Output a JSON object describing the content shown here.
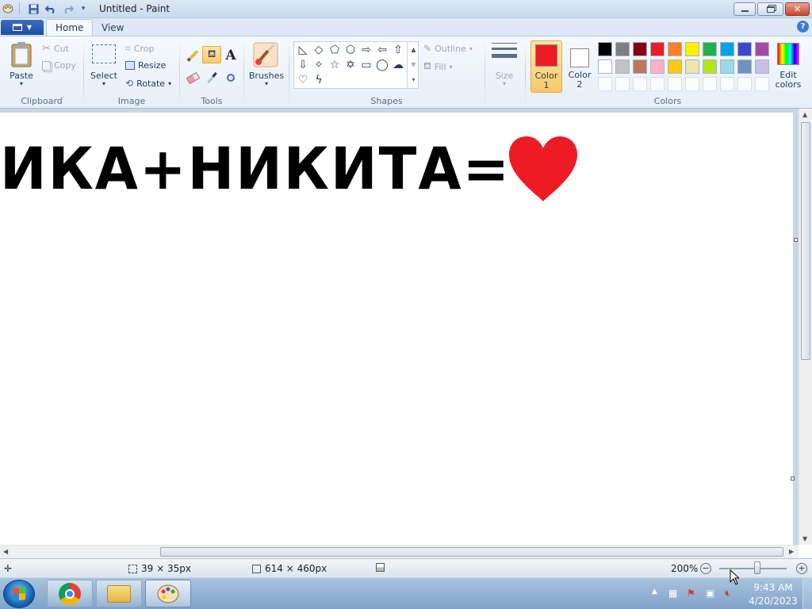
{
  "window": {
    "title": "Untitled - Paint",
    "min_icon": "minimize-icon",
    "max_icon": "restore-icon",
    "close_icon": "close-icon"
  },
  "tabs": {
    "home": "Home",
    "view": "View"
  },
  "ribbon": {
    "clipboard": {
      "label": "Clipboard",
      "paste": "Paste",
      "cut": "Cut",
      "copy": "Copy"
    },
    "image": {
      "label": "Image",
      "select": "Select",
      "crop": "Crop",
      "resize": "Resize",
      "rotate": "Rotate"
    },
    "tools": {
      "label": "Tools",
      "text_glyph": "A"
    },
    "brushes": {
      "label": "Brushes"
    },
    "shapes": {
      "label": "Shapes",
      "outline": "Outline",
      "fill": "Fill"
    },
    "size": {
      "label": "Size"
    },
    "colors": {
      "label": "Colors",
      "color1_line1": "Color",
      "color1_line2": "1",
      "color2_line1": "Color",
      "color2_line2": "2",
      "edit_line1": "Edit",
      "edit_line2": "colors",
      "color1": "#ed1c24",
      "color2": "#ffffff",
      "row1": [
        "#000000",
        "#7f7f7f",
        "#880015",
        "#ed1c24",
        "#ff7f27",
        "#fff200",
        "#22b14c",
        "#00a2e8",
        "#3f48cc",
        "#a349a4"
      ],
      "row2": [
        "#ffffff",
        "#c3c3c3",
        "#b97a57",
        "#ffaec9",
        "#ffc90e",
        "#efe4b0",
        "#b5e61d",
        "#99d9ea",
        "#7092be",
        "#c8bfe7"
      ]
    }
  },
  "canvas": {
    "text": "ИКА+НИКИТА=",
    "heart_color": "#ed1c24"
  },
  "status": {
    "selection_size": "39 × 35px",
    "image_size": "614 × 460px",
    "zoom": "200%"
  },
  "taskbar": {
    "time": "9:43 AM",
    "date": "4/20/2023"
  }
}
